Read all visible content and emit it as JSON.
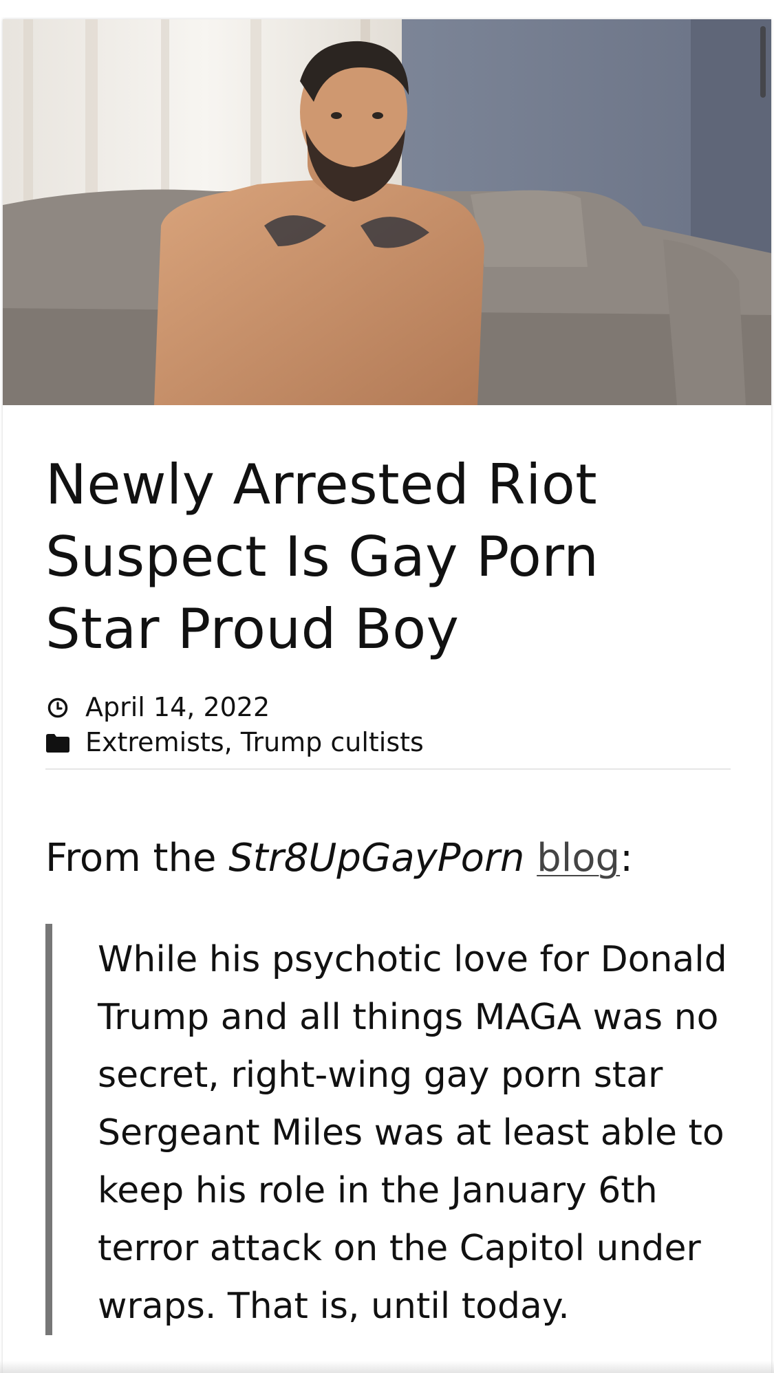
{
  "hero": {
    "image": "shirtless-tattooed-man-on-gray-couch"
  },
  "article": {
    "title": "Newly Arrested Riot Suspect Is Gay Porn Star Proud Boy",
    "date": "April 14, 2022",
    "date_icon": "clock-icon",
    "categories_icon": "folder-icon",
    "categories": [
      {
        "label": "Extremists",
        "sep": ", "
      },
      {
        "label": "Trump cultists",
        "sep": ""
      }
    ],
    "lead": {
      "prefix": "From the ",
      "source": "Str8UpGayPorn",
      "space": " ",
      "link": "blog",
      "suffix": ":"
    },
    "quote": "While his psychotic love for Donald Trump and all things MAGA was no secret, right-wing gay porn star Sergeant Miles was at least able to keep his role in the January 6th terror attack on the Capitol under wraps. That is, until today."
  },
  "colors": {
    "text": "#111111",
    "link": "#444444",
    "quote_bar": "#777777",
    "divider": "#e6e6e6"
  }
}
